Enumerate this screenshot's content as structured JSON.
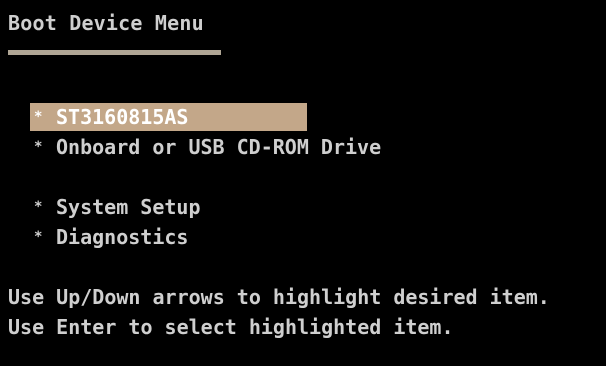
{
  "title": "Boot Device Menu",
  "menu": {
    "bullet": "*",
    "items": [
      {
        "label": "ST3160815AS",
        "selected": true
      },
      {
        "label": "Onboard or USB CD-ROM Drive",
        "selected": false
      },
      {
        "label": "System Setup",
        "selected": false
      },
      {
        "label": "Diagnostics",
        "selected": false
      }
    ]
  },
  "help": {
    "line1": "Use Up/Down arrows to highlight desired item.",
    "line2": "Use Enter to select highlighted item."
  },
  "colors": {
    "background": "#000000",
    "text": "#cfcfcf",
    "highlight": "#c3a789",
    "underline": "#b0a695"
  }
}
